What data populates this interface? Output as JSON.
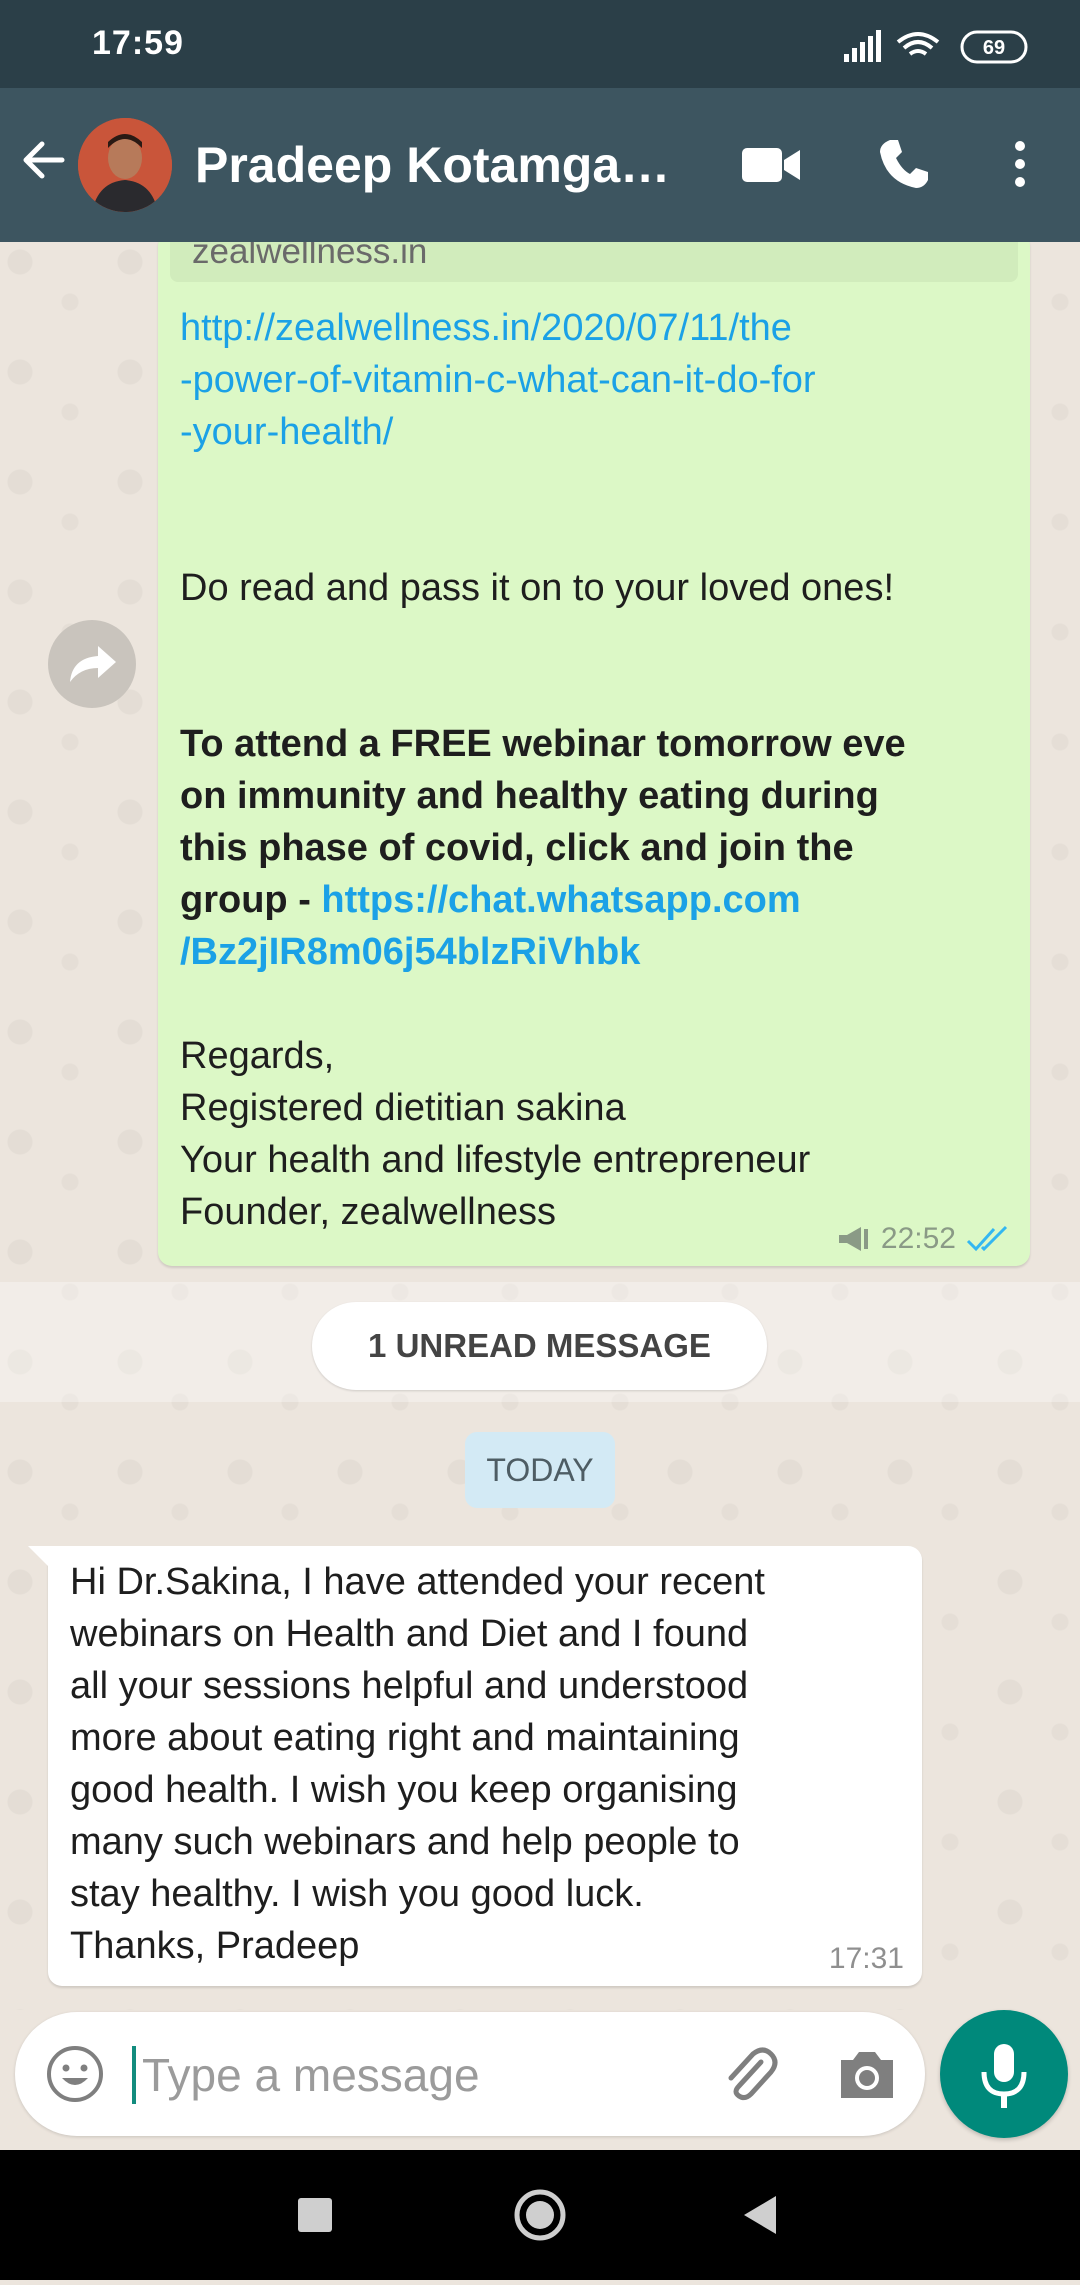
{
  "status_bar": {
    "time": "17:59",
    "battery": "69"
  },
  "header": {
    "contact_name": "Pradeep Kotamgari..."
  },
  "outgoing_message": {
    "link_preview_domain": "zealwellness.in",
    "link_lines": [
      "http://zealwellness.in/2020/07/11/the",
      "-power-of-vitamin-c-what-can-it-do-for",
      "-your-health/"
    ],
    "pass_on": "Do read and pass it on to your loved ones!",
    "webinar_lines": [
      "To attend a FREE webinar tomorrow eve",
      "on immunity and healthy eating during",
      "this phase of covid, click and join the"
    ],
    "group_prefix": "group - ",
    "group_link_lines": [
      "https://chat.whatsapp.com",
      "/Bz2jIR8m06j54blzRiVhbk"
    ],
    "signature_lines": [
      "Regards,",
      "Registered dietitian sakina",
      "Your health and lifestyle entrepreneur",
      "Founder, zealwellness"
    ],
    "time": "22:52"
  },
  "unread_label": "1 UNREAD MESSAGE",
  "date_label": "TODAY",
  "incoming_message": {
    "lines": [
      "Hi Dr.Sakina, I have attended your recent",
      "webinars on Health and Diet and I found",
      "all your sessions helpful and understood",
      "more about eating right and maintaining",
      "good health. I wish you keep organising",
      "many such webinars and help people to",
      "stay healthy. I wish you good luck.",
      "Thanks, Pradeep"
    ],
    "time": "17:31"
  },
  "composer": {
    "placeholder": "Type a message"
  },
  "colors": {
    "header": "#3d5560",
    "outgoing_bubble": "#dcf8c6",
    "link": "#1ba1e6",
    "mic_button": "#00897b"
  }
}
